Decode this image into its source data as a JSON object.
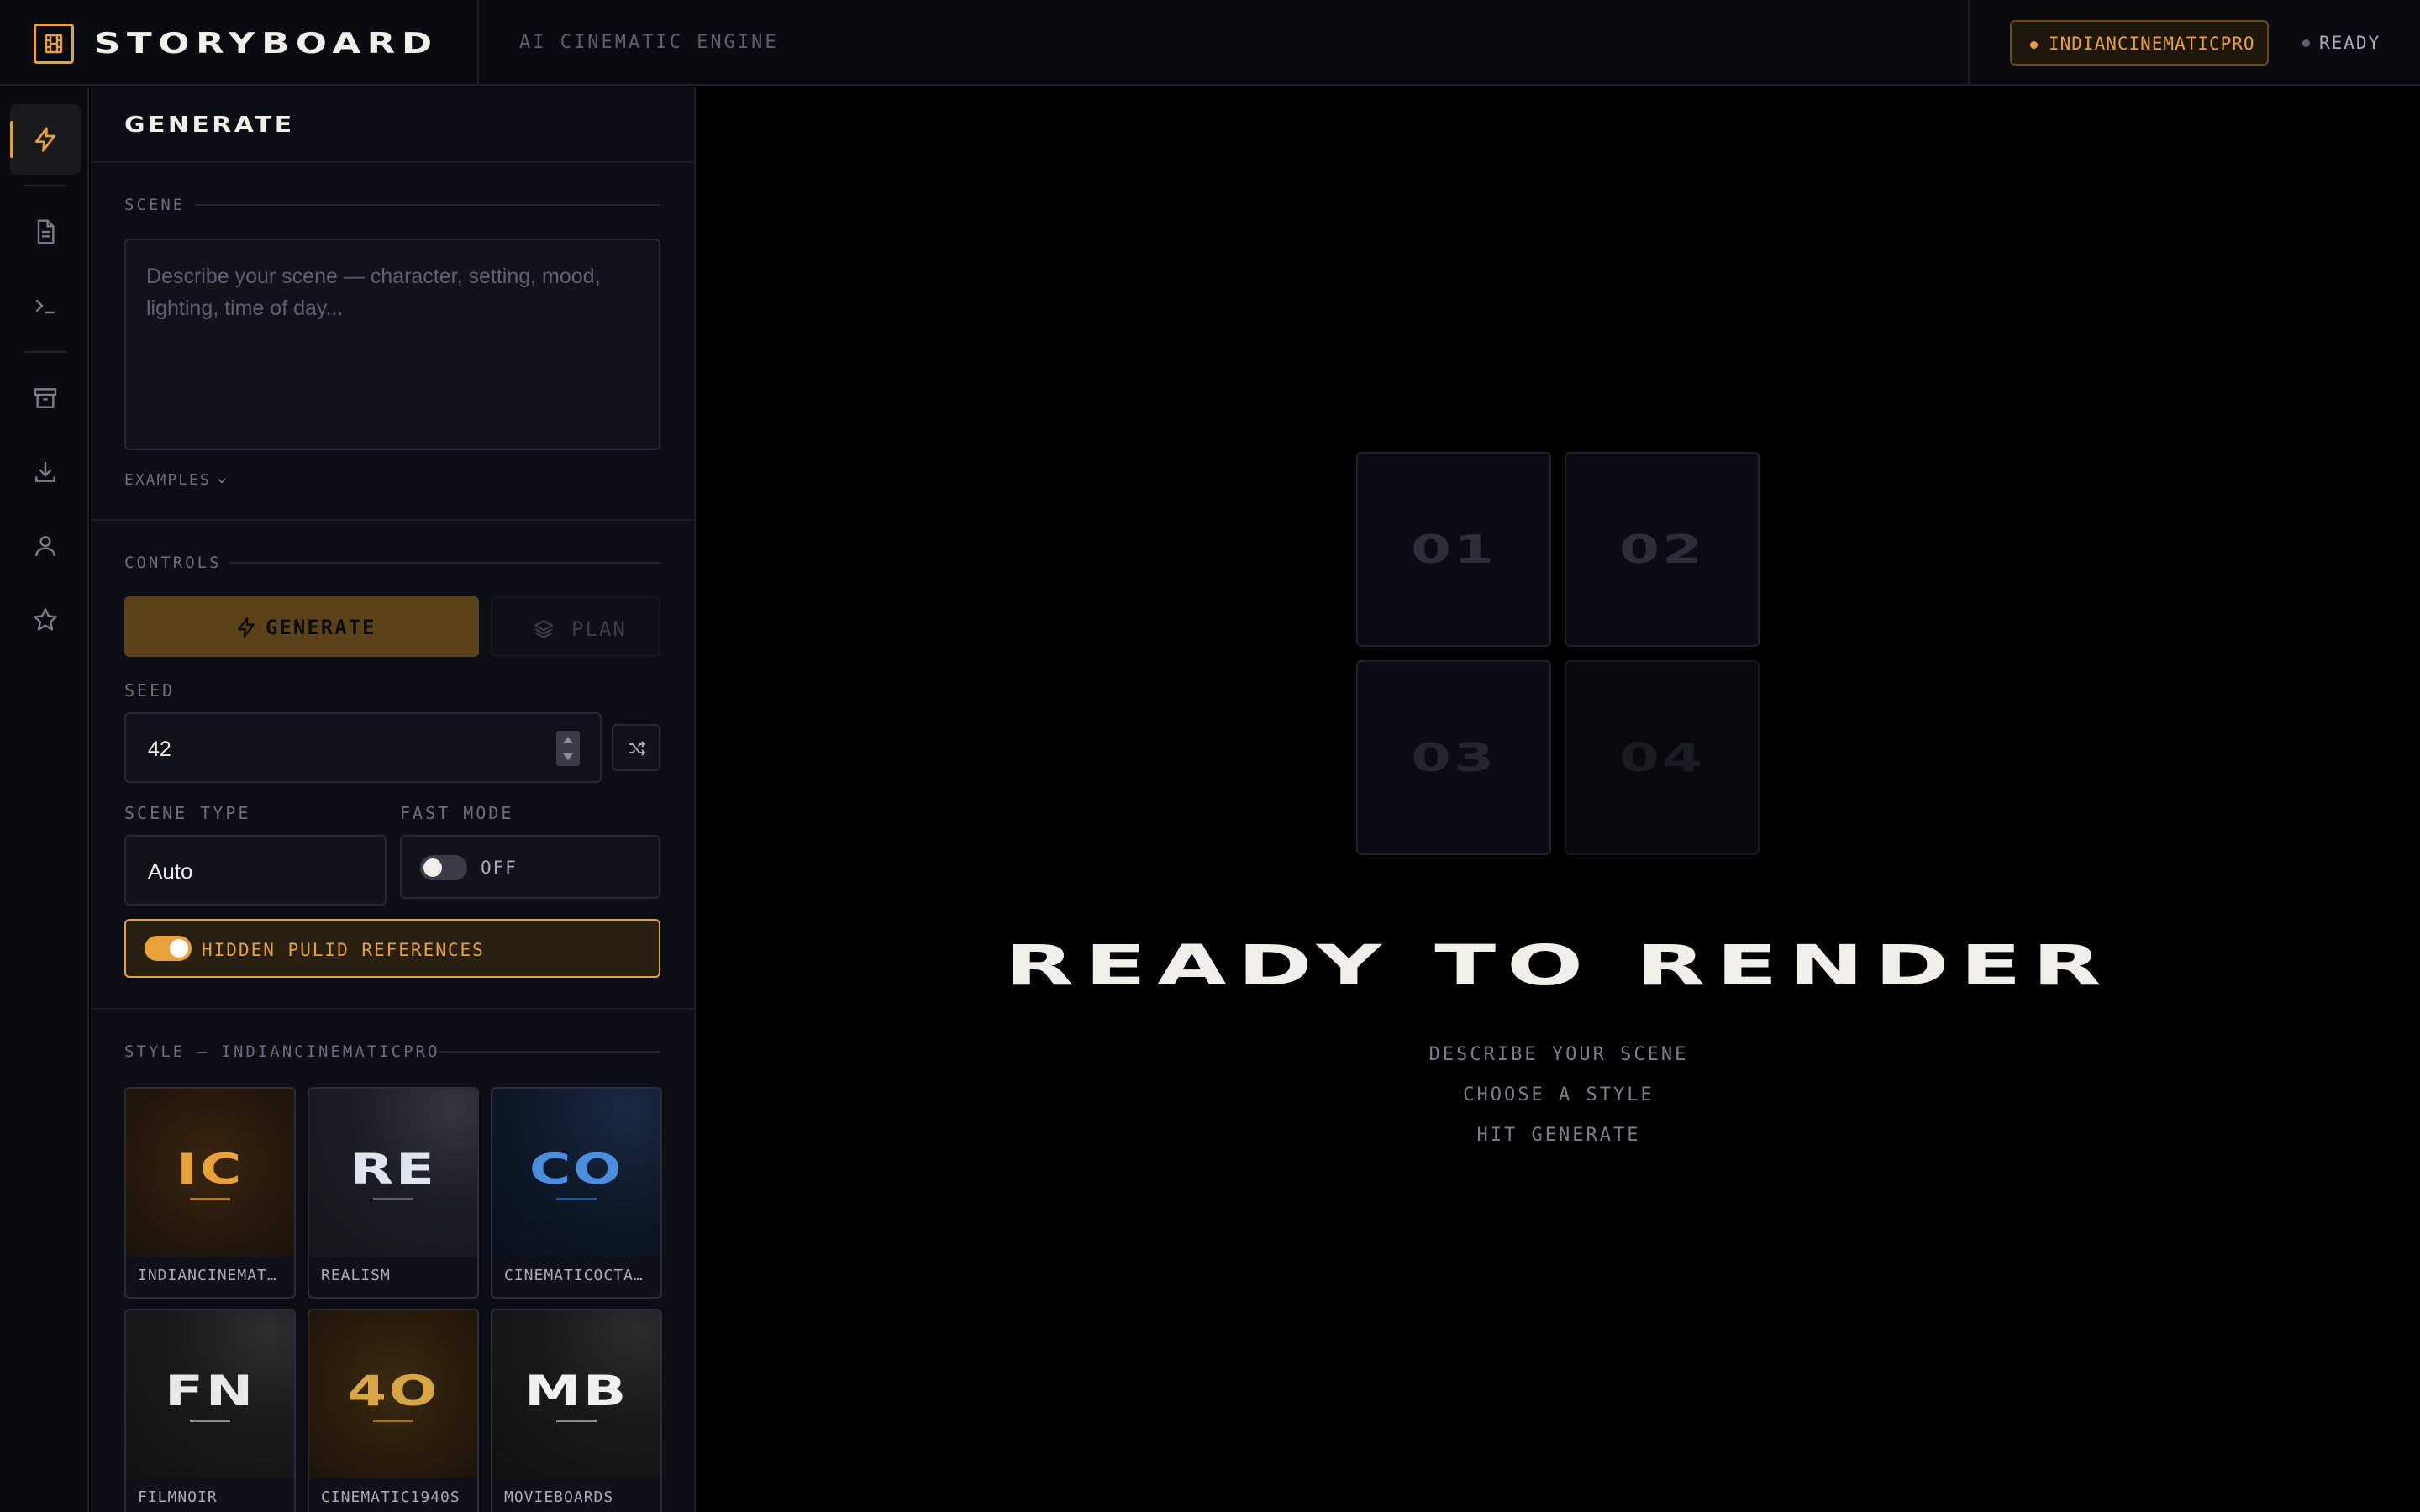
{
  "header": {
    "brand": "STORYBOARD",
    "tagline": "AI CINEMATIC ENGINE",
    "style_badge": "INDIANCINEMATICPRO",
    "status": "READY",
    "logo_icon": "film-icon"
  },
  "rail": {
    "items": [
      {
        "icon": "bolt-icon",
        "active": true
      },
      {
        "icon": "document-icon",
        "active": false
      },
      {
        "icon": "terminal-icon",
        "active": false
      },
      {
        "icon": "archive-icon",
        "active": false
      },
      {
        "icon": "download-icon",
        "active": false
      },
      {
        "icon": "user-icon",
        "active": false
      },
      {
        "icon": "star-icon",
        "active": false
      }
    ]
  },
  "panel": {
    "title": "GENERATE",
    "scene": {
      "label": "SCENE",
      "value": "",
      "placeholder": "Describe your scene — character, setting, mood, lighting, time of day...",
      "examples_label": "EXAMPLES"
    },
    "controls": {
      "label": "CONTROLS",
      "generate_label": "GENERATE",
      "plan_label": "PLAN",
      "seed_label": "SEED",
      "seed_value": "42",
      "scene_type_label": "SCENE TYPE",
      "scene_type_value": "Auto",
      "fast_mode_label": "FAST MODE",
      "fast_mode_state": "OFF",
      "pulid_label": "HIDDEN PULID REFERENCES",
      "pulid_enabled": true
    },
    "style": {
      "label": "STYLE — INDIANCINEMATICPRO",
      "cards": [
        {
          "abbr": "IC",
          "name": "INDIANCINEMAT…",
          "color": "#e8a23a"
        },
        {
          "abbr": "RE",
          "name": "REALISM",
          "color": "#dfe6f2"
        },
        {
          "abbr": "CO",
          "name": "CINEMATICOCTA…",
          "color": "#4a8ee0"
        },
        {
          "abbr": "FN",
          "name": "FILMNOIR",
          "color": "#e8e8e8"
        },
        {
          "abbr": "4O",
          "name": "CINEMATIC1940S",
          "color": "#d8a545"
        },
        {
          "abbr": "MB",
          "name": "MOVIEBOARDS",
          "color": "#f0f0f0"
        }
      ]
    }
  },
  "main": {
    "tiles": [
      "01",
      "02",
      "03",
      "04"
    ],
    "headline": "READY TO RENDER",
    "steps": [
      "DESCRIBE YOUR SCENE",
      "CHOOSE A STYLE",
      "HIT GENERATE"
    ]
  },
  "colors": {
    "accent": "#e8a23a",
    "background": "#000000",
    "panel": "#0c0e16"
  }
}
